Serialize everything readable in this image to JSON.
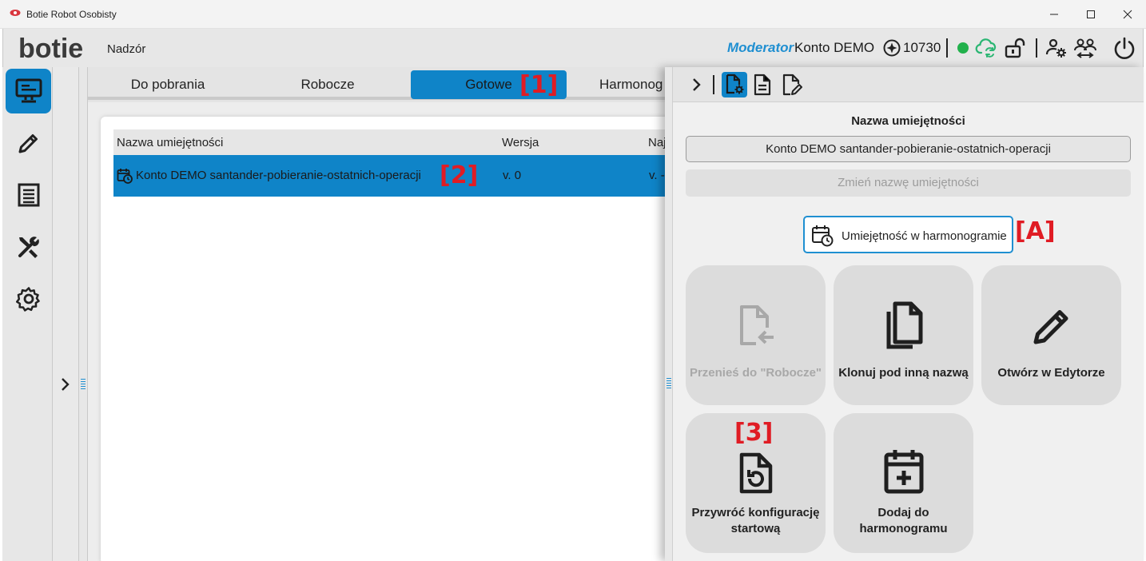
{
  "window": {
    "title": "Botie Robot Osobisty"
  },
  "header": {
    "logo_text": "botie",
    "page_name": "Nadzór",
    "role": "Moderator",
    "account": "Konto DEMO",
    "credits": "10730"
  },
  "tabs": [
    {
      "label": "Do pobrania"
    },
    {
      "label": "Robocze"
    },
    {
      "label": "Gotowe"
    },
    {
      "label": "Harmonog"
    }
  ],
  "table": {
    "columns": [
      "Nazwa umiejętności",
      "Wersja",
      "Naj"
    ],
    "rows": [
      {
        "name": "Konto DEMO santander-pobieranie-ostatnich-operacji",
        "version": "v. 0",
        "extra": "v. -"
      }
    ]
  },
  "detail": {
    "field_label": "Nazwa umiejętności",
    "name_value": "Konto DEMO santander-pobieranie-ostatnich-operacji",
    "rename_label": "Zmień nazwę umiejętności",
    "schedule_badge": "Umiejętność w harmonogramie",
    "actions": [
      {
        "label": "Przenieś do \"Robocze\"",
        "enabled": false
      },
      {
        "label": "Klonuj pod inną nazwą",
        "enabled": true
      },
      {
        "label": "Otwórz w Edytorze",
        "enabled": true
      },
      {
        "label": "Przywróć konfigurację startową",
        "enabled": true
      },
      {
        "label": "Dodaj do harmonogramu",
        "enabled": true
      }
    ]
  },
  "annotations": {
    "a1": "[1]",
    "a2": "[2]",
    "a3": "[3]",
    "aA": "[A]"
  },
  "colors": {
    "accent": "#0f84c8",
    "role_text": "#1f8fd1",
    "online": "#22b14c",
    "cloud": "#2bb673",
    "annotation": "#e01c24"
  }
}
